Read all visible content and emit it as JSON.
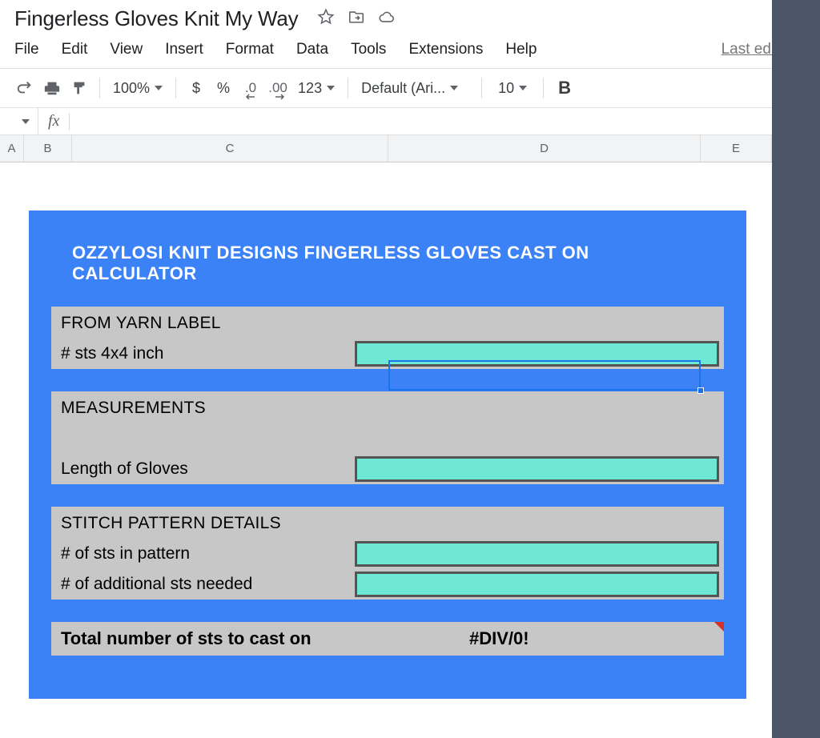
{
  "doc": {
    "title": "Fingerless Gloves Knit My Way",
    "last_edit": "Last edit wa"
  },
  "menu": {
    "file": "File",
    "edit": "Edit",
    "view": "View",
    "insert": "Insert",
    "format": "Format",
    "data": "Data",
    "tools": "Tools",
    "extensions": "Extensions",
    "help": "Help"
  },
  "toolbar": {
    "zoom": "100%",
    "currency": "$",
    "percent": "%",
    "dec_dec": ".0",
    "inc_dec": ".00",
    "more_formats": "123",
    "font_name": "Default (Ari...",
    "font_size": "10",
    "bold": "B"
  },
  "formula": {
    "fx": "fx",
    "value": ""
  },
  "columns": {
    "a": "A",
    "b": "B",
    "c": "C",
    "d": "D",
    "e": "E"
  },
  "calculator": {
    "title": "OZZYLOSI KNIT DESIGNS FINGERLESS GLOVES CAST ON CALCULATOR",
    "section1_header": "FROM YARN LABEL",
    "section1_row1": "# sts 4x4 inch",
    "section2_header": "MEASUREMENTS",
    "section2_row1": "Length of Gloves",
    "section3_header": "STITCH PATTERN DETAILS",
    "section3_row1": "# of sts in pattern",
    "section3_row2": "# of additional sts needed",
    "total_label": "Total number of sts to cast on",
    "total_value": "#DIV/0!"
  },
  "colors": {
    "accent_blue": "#3b82f6",
    "input_teal": "#6ee7d4",
    "section_grey": "#c7c7c7"
  }
}
